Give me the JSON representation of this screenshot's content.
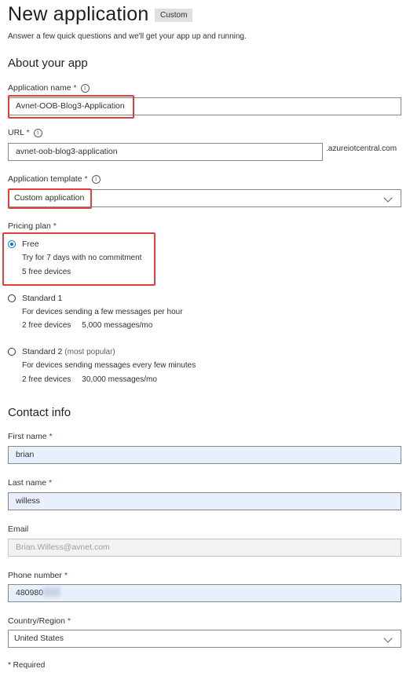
{
  "page": {
    "title": "New application",
    "badge": "Custom",
    "subtitle": "Answer a few quick questions and we'll get your app up and running."
  },
  "about": {
    "heading": "About your app",
    "app_name": {
      "label": "Application name",
      "required": "*",
      "value": "Avnet-OOB-Blog3-Application"
    },
    "url": {
      "label": "URL",
      "required": "*",
      "value": "avnet-oob-blog3-application",
      "suffix": ".azureiotcentral.com"
    },
    "template": {
      "label": "Application template",
      "required": "*",
      "value": "Custom application"
    }
  },
  "pricing": {
    "label": "Pricing plan",
    "required": "*",
    "options": [
      {
        "title": "Free",
        "extra": "",
        "line1": "Try for 7 days with no commitment",
        "line2a": "5 free devices",
        "line2b": "",
        "selected": true
      },
      {
        "title": "Standard 1",
        "extra": "",
        "line1": "For devices sending a few messages per hour",
        "line2a": "2 free devices",
        "line2b": "5,000 messages/mo",
        "selected": false
      },
      {
        "title": "Standard 2",
        "extra": "(most popular)",
        "line1": "For devices sending messages every few minutes",
        "line2a": "2 free devices",
        "line2b": "30,000 messages/mo",
        "selected": false
      }
    ]
  },
  "contact": {
    "heading": "Contact info",
    "first_name": {
      "label": "First name",
      "required": "*",
      "value": "brian"
    },
    "last_name": {
      "label": "Last name",
      "required": "*",
      "value": "willess"
    },
    "email": {
      "label": "Email",
      "value": "Brian.Willess@avnet.com"
    },
    "phone": {
      "label": "Phone number",
      "required": "*",
      "value": "480980"
    },
    "country": {
      "label": "Country/Region",
      "required": "*",
      "value": "United States"
    }
  },
  "footer": {
    "required_note": "* Required"
  },
  "colors": {
    "accent": "#0078d4",
    "highlight": "#e0403a",
    "autofill": "#e8f0fe"
  }
}
